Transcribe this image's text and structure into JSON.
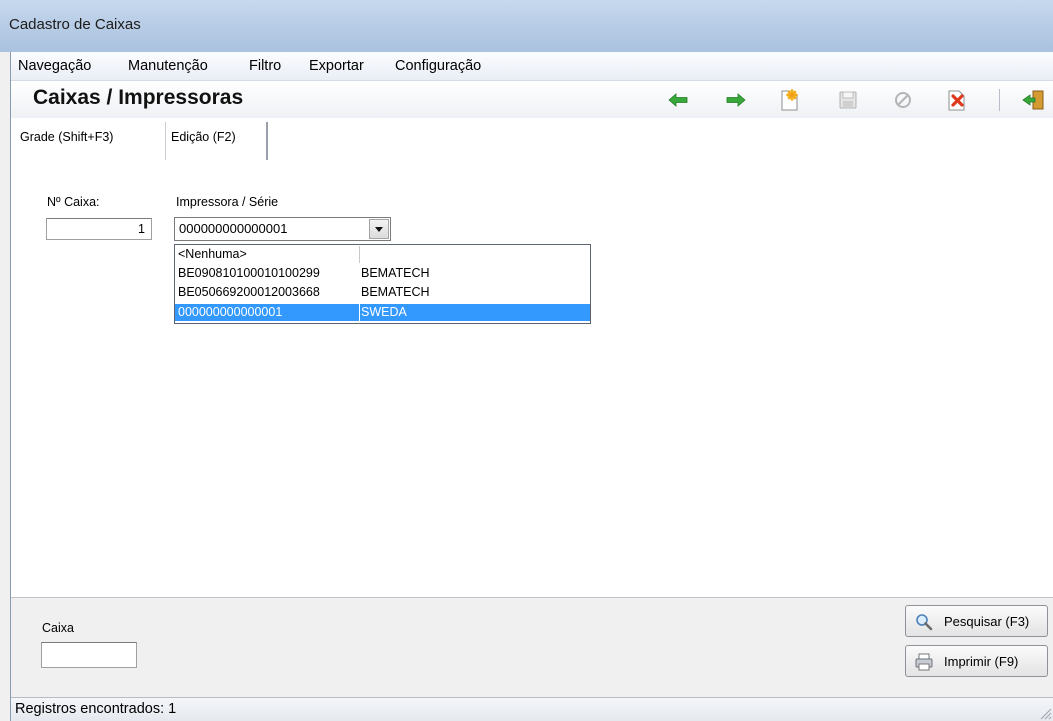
{
  "window": {
    "title": "Cadastro de Caixas"
  },
  "menu": {
    "items": [
      "Navegação",
      "Manutenção",
      "Filtro",
      "Exportar",
      "Configuração"
    ]
  },
  "header": {
    "title": "Caixas / Impressoras",
    "toolbar_icons": [
      "arrow-left-icon",
      "arrow-right-icon",
      "new-record-icon",
      "save-icon",
      "cancel-icon",
      "delete-icon",
      "exit-icon"
    ]
  },
  "tabs": [
    {
      "label": "Grade (Shift+F3)",
      "active": false
    },
    {
      "label": "Edição (F2)",
      "active": true
    }
  ],
  "form": {
    "caixa_label": "Nº Caixa:",
    "caixa_value": "1",
    "printer_label": "Impressora / Série",
    "printer_value": "000000000000001"
  },
  "dropdown": {
    "options": [
      {
        "serial": "<Nenhuma>",
        "brand": "",
        "selected": false
      },
      {
        "serial": "BE090810100010100299",
        "brand": "BEMATECH",
        "selected": false
      },
      {
        "serial": "BE050669200012003668",
        "brand": "BEMATECH",
        "selected": false
      },
      {
        "serial": "000000000000001",
        "brand": "SWEDA",
        "selected": true
      }
    ]
  },
  "filter": {
    "label": "Caixa",
    "value": "",
    "search_button": "Pesquisar (F3)",
    "print_button": "Imprimir (F9)"
  },
  "status": {
    "text": "Registros encontrados: 1"
  },
  "colors": {
    "selection": "#3399ff",
    "nav_arrow": "#2fa52f"
  }
}
